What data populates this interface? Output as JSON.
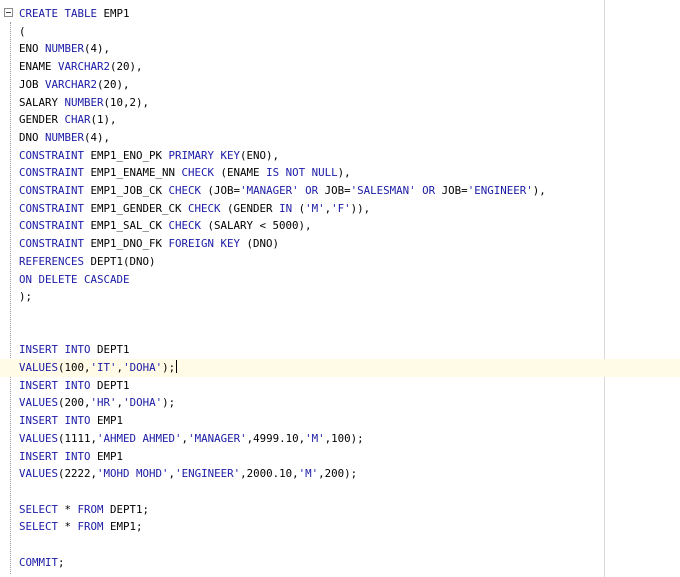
{
  "editor": {
    "current_line_index": 20,
    "lines": [
      [
        {
          "t": "kw",
          "v": "CREATE"
        },
        {
          "t": "plain",
          "v": " "
        },
        {
          "t": "kw",
          "v": "TABLE"
        },
        {
          "t": "plain",
          "v": " EMP1"
        }
      ],
      [
        {
          "t": "plain",
          "v": "("
        }
      ],
      [
        {
          "t": "plain",
          "v": "ENO "
        },
        {
          "t": "kw",
          "v": "NUMBER"
        },
        {
          "t": "plain",
          "v": "(4),"
        }
      ],
      [
        {
          "t": "plain",
          "v": "ENAME "
        },
        {
          "t": "kw",
          "v": "VARCHAR2"
        },
        {
          "t": "plain",
          "v": "(20),"
        }
      ],
      [
        {
          "t": "plain",
          "v": "JOB "
        },
        {
          "t": "kw",
          "v": "VARCHAR2"
        },
        {
          "t": "plain",
          "v": "(20),"
        }
      ],
      [
        {
          "t": "plain",
          "v": "SALARY "
        },
        {
          "t": "kw",
          "v": "NUMBER"
        },
        {
          "t": "plain",
          "v": "(10,2),"
        }
      ],
      [
        {
          "t": "plain",
          "v": "GENDER "
        },
        {
          "t": "kw",
          "v": "CHAR"
        },
        {
          "t": "plain",
          "v": "(1),"
        }
      ],
      [
        {
          "t": "plain",
          "v": "DNO "
        },
        {
          "t": "kw",
          "v": "NUMBER"
        },
        {
          "t": "plain",
          "v": "(4),"
        }
      ],
      [
        {
          "t": "kw",
          "v": "CONSTRAINT"
        },
        {
          "t": "plain",
          "v": " EMP1_ENO_PK "
        },
        {
          "t": "kw",
          "v": "PRIMARY KEY"
        },
        {
          "t": "plain",
          "v": "(ENO),"
        }
      ],
      [
        {
          "t": "kw",
          "v": "CONSTRAINT"
        },
        {
          "t": "plain",
          "v": " EMP1_ENAME_NN "
        },
        {
          "t": "kw",
          "v": "CHECK"
        },
        {
          "t": "plain",
          "v": " (ENAME "
        },
        {
          "t": "kw",
          "v": "IS NOT NULL"
        },
        {
          "t": "plain",
          "v": "),"
        }
      ],
      [
        {
          "t": "kw",
          "v": "CONSTRAINT"
        },
        {
          "t": "plain",
          "v": " EMP1_JOB_CK "
        },
        {
          "t": "kw",
          "v": "CHECK"
        },
        {
          "t": "plain",
          "v": " (JOB="
        },
        {
          "t": "str",
          "v": "'MANAGER'"
        },
        {
          "t": "plain",
          "v": " "
        },
        {
          "t": "kw",
          "v": "OR"
        },
        {
          "t": "plain",
          "v": " JOB="
        },
        {
          "t": "str",
          "v": "'SALESMAN'"
        },
        {
          "t": "plain",
          "v": " "
        },
        {
          "t": "kw",
          "v": "OR"
        },
        {
          "t": "plain",
          "v": " JOB="
        },
        {
          "t": "str",
          "v": "'ENGINEER'"
        },
        {
          "t": "plain",
          "v": "),"
        }
      ],
      [
        {
          "t": "kw",
          "v": "CONSTRAINT"
        },
        {
          "t": "plain",
          "v": " EMP1_GENDER_CK "
        },
        {
          "t": "kw",
          "v": "CHECK"
        },
        {
          "t": "plain",
          "v": " (GENDER "
        },
        {
          "t": "kw",
          "v": "IN"
        },
        {
          "t": "plain",
          "v": " ("
        },
        {
          "t": "str",
          "v": "'M'"
        },
        {
          "t": "plain",
          "v": ","
        },
        {
          "t": "str",
          "v": "'F'"
        },
        {
          "t": "plain",
          "v": ")),"
        }
      ],
      [
        {
          "t": "kw",
          "v": "CONSTRAINT"
        },
        {
          "t": "plain",
          "v": " EMP1_SAL_CK "
        },
        {
          "t": "kw",
          "v": "CHECK"
        },
        {
          "t": "plain",
          "v": " (SALARY < 5000),"
        }
      ],
      [
        {
          "t": "kw",
          "v": "CONSTRAINT"
        },
        {
          "t": "plain",
          "v": " EMP1_DNO_FK "
        },
        {
          "t": "kw",
          "v": "FOREIGN KEY"
        },
        {
          "t": "plain",
          "v": " (DNO)"
        }
      ],
      [
        {
          "t": "kw",
          "v": "REFERENCES"
        },
        {
          "t": "plain",
          "v": " DEPT1(DNO)"
        }
      ],
      [
        {
          "t": "kw",
          "v": "ON DELETE CASCADE"
        }
      ],
      [
        {
          "t": "plain",
          "v": ");"
        }
      ],
      [],
      [],
      [
        {
          "t": "kw",
          "v": "INSERT INTO"
        },
        {
          "t": "plain",
          "v": " DEPT1"
        }
      ],
      [
        {
          "t": "kw",
          "v": "VALUES"
        },
        {
          "t": "plain",
          "v": "(100,"
        },
        {
          "t": "str",
          "v": "'IT'"
        },
        {
          "t": "plain",
          "v": ","
        },
        {
          "t": "str",
          "v": "'DOHA'"
        },
        {
          "t": "plain",
          "v": ");"
        }
      ],
      [
        {
          "t": "kw",
          "v": "INSERT INTO"
        },
        {
          "t": "plain",
          "v": " DEPT1"
        }
      ],
      [
        {
          "t": "kw",
          "v": "VALUES"
        },
        {
          "t": "plain",
          "v": "(200,"
        },
        {
          "t": "str",
          "v": "'HR'"
        },
        {
          "t": "plain",
          "v": ","
        },
        {
          "t": "str",
          "v": "'DOHA'"
        },
        {
          "t": "plain",
          "v": ");"
        }
      ],
      [
        {
          "t": "kw",
          "v": "INSERT INTO"
        },
        {
          "t": "plain",
          "v": " EMP1"
        }
      ],
      [
        {
          "t": "kw",
          "v": "VALUES"
        },
        {
          "t": "plain",
          "v": "(1111,"
        },
        {
          "t": "str",
          "v": "'AHMED AHMED'"
        },
        {
          "t": "plain",
          "v": ","
        },
        {
          "t": "str",
          "v": "'MANAGER'"
        },
        {
          "t": "plain",
          "v": ",4999.10,"
        },
        {
          "t": "str",
          "v": "'M'"
        },
        {
          "t": "plain",
          "v": ",100);"
        }
      ],
      [
        {
          "t": "kw",
          "v": "INSERT INTO"
        },
        {
          "t": "plain",
          "v": " EMP1"
        }
      ],
      [
        {
          "t": "kw",
          "v": "VALUES"
        },
        {
          "t": "plain",
          "v": "(2222,"
        },
        {
          "t": "str",
          "v": "'MOHD MOHD'"
        },
        {
          "t": "plain",
          "v": ","
        },
        {
          "t": "str",
          "v": "'ENGINEER'"
        },
        {
          "t": "plain",
          "v": ",2000.10,"
        },
        {
          "t": "str",
          "v": "'M'"
        },
        {
          "t": "plain",
          "v": ",200);"
        }
      ],
      [],
      [
        {
          "t": "kw",
          "v": "SELECT"
        },
        {
          "t": "plain",
          "v": " * "
        },
        {
          "t": "kw",
          "v": "FROM"
        },
        {
          "t": "plain",
          "v": " DEPT1;"
        }
      ],
      [
        {
          "t": "kw",
          "v": "SELECT"
        },
        {
          "t": "plain",
          "v": " * "
        },
        {
          "t": "kw",
          "v": "FROM"
        },
        {
          "t": "plain",
          "v": " EMP1;"
        }
      ],
      [],
      [
        {
          "t": "kw",
          "v": "COMMIT"
        },
        {
          "t": "plain",
          "v": ";"
        }
      ]
    ]
  }
}
